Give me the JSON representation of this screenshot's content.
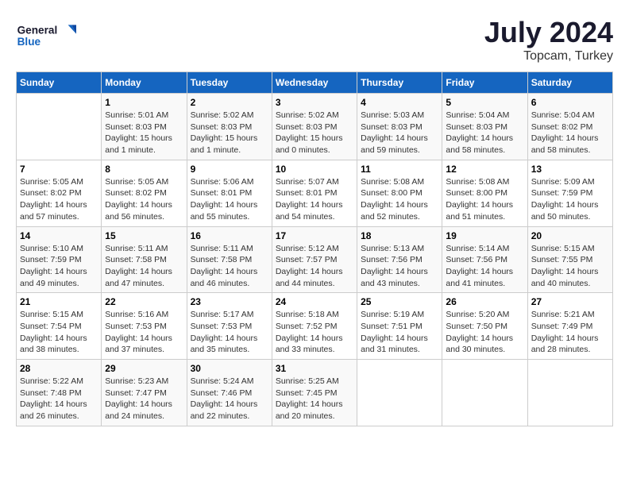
{
  "header": {
    "logo_line1": "General",
    "logo_line2": "Blue",
    "month": "July 2024",
    "location": "Topcam, Turkey"
  },
  "days_of_week": [
    "Sunday",
    "Monday",
    "Tuesday",
    "Wednesday",
    "Thursday",
    "Friday",
    "Saturday"
  ],
  "weeks": [
    [
      {
        "day": "",
        "info": ""
      },
      {
        "day": "1",
        "info": "Sunrise: 5:01 AM\nSunset: 8:03 PM\nDaylight: 15 hours\nand 1 minute."
      },
      {
        "day": "2",
        "info": "Sunrise: 5:02 AM\nSunset: 8:03 PM\nDaylight: 15 hours\nand 1 minute."
      },
      {
        "day": "3",
        "info": "Sunrise: 5:02 AM\nSunset: 8:03 PM\nDaylight: 15 hours\nand 0 minutes."
      },
      {
        "day": "4",
        "info": "Sunrise: 5:03 AM\nSunset: 8:03 PM\nDaylight: 14 hours\nand 59 minutes."
      },
      {
        "day": "5",
        "info": "Sunrise: 5:04 AM\nSunset: 8:03 PM\nDaylight: 14 hours\nand 58 minutes."
      },
      {
        "day": "6",
        "info": "Sunrise: 5:04 AM\nSunset: 8:02 PM\nDaylight: 14 hours\nand 58 minutes."
      }
    ],
    [
      {
        "day": "7",
        "info": "Sunrise: 5:05 AM\nSunset: 8:02 PM\nDaylight: 14 hours\nand 57 minutes."
      },
      {
        "day": "8",
        "info": "Sunrise: 5:05 AM\nSunset: 8:02 PM\nDaylight: 14 hours\nand 56 minutes."
      },
      {
        "day": "9",
        "info": "Sunrise: 5:06 AM\nSunset: 8:01 PM\nDaylight: 14 hours\nand 55 minutes."
      },
      {
        "day": "10",
        "info": "Sunrise: 5:07 AM\nSunset: 8:01 PM\nDaylight: 14 hours\nand 54 minutes."
      },
      {
        "day": "11",
        "info": "Sunrise: 5:08 AM\nSunset: 8:00 PM\nDaylight: 14 hours\nand 52 minutes."
      },
      {
        "day": "12",
        "info": "Sunrise: 5:08 AM\nSunset: 8:00 PM\nDaylight: 14 hours\nand 51 minutes."
      },
      {
        "day": "13",
        "info": "Sunrise: 5:09 AM\nSunset: 7:59 PM\nDaylight: 14 hours\nand 50 minutes."
      }
    ],
    [
      {
        "day": "14",
        "info": "Sunrise: 5:10 AM\nSunset: 7:59 PM\nDaylight: 14 hours\nand 49 minutes."
      },
      {
        "day": "15",
        "info": "Sunrise: 5:11 AM\nSunset: 7:58 PM\nDaylight: 14 hours\nand 47 minutes."
      },
      {
        "day": "16",
        "info": "Sunrise: 5:11 AM\nSunset: 7:58 PM\nDaylight: 14 hours\nand 46 minutes."
      },
      {
        "day": "17",
        "info": "Sunrise: 5:12 AM\nSunset: 7:57 PM\nDaylight: 14 hours\nand 44 minutes."
      },
      {
        "day": "18",
        "info": "Sunrise: 5:13 AM\nSunset: 7:56 PM\nDaylight: 14 hours\nand 43 minutes."
      },
      {
        "day": "19",
        "info": "Sunrise: 5:14 AM\nSunset: 7:56 PM\nDaylight: 14 hours\nand 41 minutes."
      },
      {
        "day": "20",
        "info": "Sunrise: 5:15 AM\nSunset: 7:55 PM\nDaylight: 14 hours\nand 40 minutes."
      }
    ],
    [
      {
        "day": "21",
        "info": "Sunrise: 5:15 AM\nSunset: 7:54 PM\nDaylight: 14 hours\nand 38 minutes."
      },
      {
        "day": "22",
        "info": "Sunrise: 5:16 AM\nSunset: 7:53 PM\nDaylight: 14 hours\nand 37 minutes."
      },
      {
        "day": "23",
        "info": "Sunrise: 5:17 AM\nSunset: 7:53 PM\nDaylight: 14 hours\nand 35 minutes."
      },
      {
        "day": "24",
        "info": "Sunrise: 5:18 AM\nSunset: 7:52 PM\nDaylight: 14 hours\nand 33 minutes."
      },
      {
        "day": "25",
        "info": "Sunrise: 5:19 AM\nSunset: 7:51 PM\nDaylight: 14 hours\nand 31 minutes."
      },
      {
        "day": "26",
        "info": "Sunrise: 5:20 AM\nSunset: 7:50 PM\nDaylight: 14 hours\nand 30 minutes."
      },
      {
        "day": "27",
        "info": "Sunrise: 5:21 AM\nSunset: 7:49 PM\nDaylight: 14 hours\nand 28 minutes."
      }
    ],
    [
      {
        "day": "28",
        "info": "Sunrise: 5:22 AM\nSunset: 7:48 PM\nDaylight: 14 hours\nand 26 minutes."
      },
      {
        "day": "29",
        "info": "Sunrise: 5:23 AM\nSunset: 7:47 PM\nDaylight: 14 hours\nand 24 minutes."
      },
      {
        "day": "30",
        "info": "Sunrise: 5:24 AM\nSunset: 7:46 PM\nDaylight: 14 hours\nand 22 minutes."
      },
      {
        "day": "31",
        "info": "Sunrise: 5:25 AM\nSunset: 7:45 PM\nDaylight: 14 hours\nand 20 minutes."
      },
      {
        "day": "",
        "info": ""
      },
      {
        "day": "",
        "info": ""
      },
      {
        "day": "",
        "info": ""
      }
    ]
  ]
}
